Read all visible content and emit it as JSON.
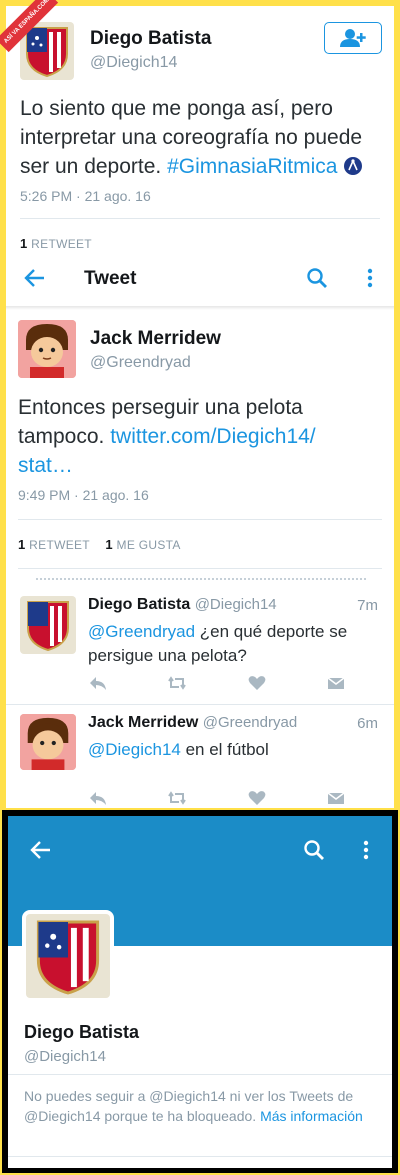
{
  "watermark": "ASÍ VA ESPAÑA.COM",
  "tweet1": {
    "name": "Diego Batista",
    "handle": "@Diegich14",
    "text_plain": "Lo siento que me ponga así, pero interpretar una coreografía no puede ser un deporte. ",
    "hashtag": "#GimnasiaRitmica",
    "time": "5:26 PM · 21 ago. 16",
    "retweets_count": "1",
    "retweets_label": "RETWEET",
    "follow_icon": "add-user-icon"
  },
  "toolbar": {
    "title": "Tweet",
    "back_icon": "arrow-left-icon",
    "search_icon": "search-icon",
    "more_icon": "more-vertical-icon"
  },
  "tweet2": {
    "name": "Jack Merridew",
    "handle": "@Greendryad",
    "text_plain": "Entonces perseguir una pelota tampoco. ",
    "link": "twitter.com/Diegich14/ stat…",
    "time": "9:49 PM · 21 ago. 16",
    "retweets_count": "1",
    "retweets_label": "RETWEET",
    "likes_count": "1",
    "likes_label": "ME GUSTA"
  },
  "replies": [
    {
      "name": "Diego Batista",
      "handle": "@Diegich14",
      "time": "7m",
      "mention": "@Greendryad",
      "text": " ¿en qué deporte se persigue una pelota?"
    },
    {
      "name": "Jack Merridew",
      "handle": "@Greendryad",
      "time": "6m",
      "mention": "@Diegich14",
      "text": " en el fútbol"
    }
  ],
  "profile": {
    "name": "Diego Batista",
    "handle": "@Diegich14",
    "blocked_text": "No puedes seguir a @Diegich14 ni ver los Tweets de @Diegich14 porque te ha bloqueado. ",
    "more_info": "Más información",
    "header_color": "#1b8cc7"
  },
  "colors": {
    "accent": "#1b95e0",
    "frame": "#ffe04a"
  }
}
